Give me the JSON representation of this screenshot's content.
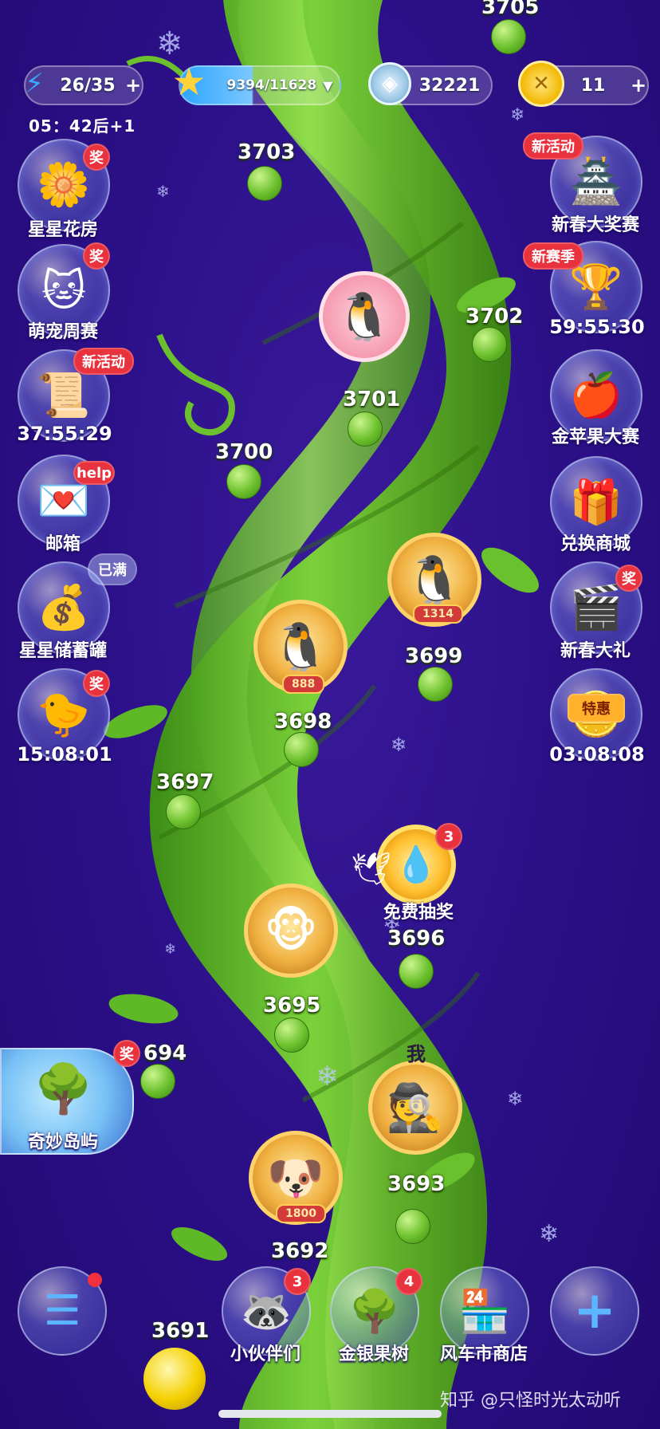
{
  "resources": {
    "energy": {
      "value": "26/35",
      "icon": "lightning-icon"
    },
    "stars": {
      "value": "9394/11628",
      "icon": "star-icon"
    },
    "gems": {
      "value": "32221",
      "icon": "gem-icon"
    },
    "coins": {
      "value": "11",
      "icon": "coin-icon"
    },
    "energy_timer": "05：42后+1"
  },
  "left_menu": [
    {
      "label": "星星花房",
      "badge": "奖",
      "icon": "flower-house-icon"
    },
    {
      "label": "萌宠周赛",
      "badge": "奖",
      "icon": "cat-pet-icon"
    },
    {
      "label": "37:55:29",
      "badge": "新活动",
      "icon": "scroll-icon"
    },
    {
      "label": "邮箱",
      "badge": "help",
      "icon": "mail-icon"
    },
    {
      "label": "星星储蓄罐",
      "badge": "已满",
      "icon": "piggy-bank-icon"
    },
    {
      "label": "15:08:01",
      "badge": "奖",
      "icon": "chick-card-icon"
    }
  ],
  "right_menu": [
    {
      "label": "新春大奖赛",
      "badge": "新活动",
      "icon": "palace-icon"
    },
    {
      "label": "59:55:30",
      "badge": "新赛季",
      "icon": "trophy-icon"
    },
    {
      "label": "金苹果大赛",
      "badge": "",
      "icon": "golden-apple-icon"
    },
    {
      "label": "兑换商城",
      "badge": "",
      "icon": "shop-icon"
    },
    {
      "label": "新春大礼",
      "badge": "奖",
      "icon": "gift-icon"
    },
    {
      "label": "03:08:08",
      "badge": "特惠",
      "icon": "discount-icon"
    }
  ],
  "island": {
    "label": "奇妙岛屿",
    "badge": "奖",
    "level_fragment": "694"
  },
  "levels": [
    "3705",
    "3703",
    "3702",
    "3701",
    "3700",
    "3699",
    "3698",
    "3697",
    "3696",
    "3695",
    "3693",
    "3692",
    "3691"
  ],
  "players": [
    {
      "tag": "",
      "emoji": "🐧"
    },
    {
      "tag": "1314",
      "emoji": "🐧"
    },
    {
      "tag": "888",
      "emoji": "🐧"
    },
    {
      "tag": "",
      "emoji": "🐵"
    },
    {
      "tag": "",
      "emoji": "🕵"
    },
    {
      "tag": "1800",
      "emoji": "🐶"
    }
  ],
  "me_marker": "我",
  "free_draw": {
    "label": "免费抽奖",
    "badge": "3"
  },
  "bottom_nav": [
    {
      "label": "",
      "badge": "",
      "icon": "menu-list-icon"
    },
    {
      "label": "小伙伴们",
      "badge": "3",
      "icon": "friends-icon"
    },
    {
      "label": "金银果树",
      "badge": "4",
      "icon": "fruit-tree-icon"
    },
    {
      "label": "风车市商店",
      "badge": "",
      "icon": "windmill-shop-icon"
    },
    {
      "label": "",
      "badge": "",
      "icon": "plus-icon"
    }
  ],
  "watermark": "知乎 @只怪时光太动听"
}
